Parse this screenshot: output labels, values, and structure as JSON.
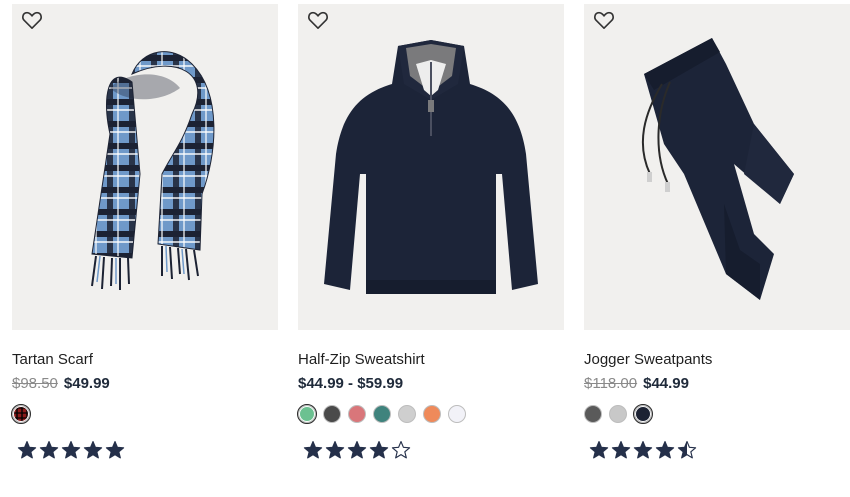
{
  "products": [
    {
      "name": "Tartan Scarf",
      "old_price": "$98.50",
      "price": "$49.99",
      "rating": 5,
      "swatches": [
        {
          "color": "#8b1a1a",
          "selected": true,
          "pattern": "plaid"
        }
      ],
      "image_icon": "scarf-image"
    },
    {
      "name": "Half-Zip Sweatshirt",
      "old_price": "",
      "price": "$44.99 - $59.99",
      "rating": 4,
      "swatches": [
        {
          "color": "#6cc191",
          "selected": true
        },
        {
          "color": "#4a4a4a",
          "selected": false
        },
        {
          "color": "#d9767a",
          "selected": false
        },
        {
          "color": "#3f837d",
          "selected": false
        },
        {
          "color": "#cfcfcf",
          "selected": false
        },
        {
          "color": "#ef8a5a",
          "selected": false
        },
        {
          "color": "#f2f2f8",
          "selected": false
        }
      ],
      "image_icon": "sweatshirt-image"
    },
    {
      "name": "Jogger Sweatpants",
      "old_price": "$118.00",
      "price": "$44.99",
      "rating": 4.5,
      "swatches": [
        {
          "color": "#5a5a5a",
          "selected": false
        },
        {
          "color": "#c8c8c8",
          "selected": false
        },
        {
          "color": "#1c2233",
          "selected": true
        }
      ],
      "image_icon": "sweatpants-image"
    }
  ],
  "colors": {
    "navy": "#1c2438",
    "star": "#25304a",
    "image_bg": "#efefef"
  }
}
